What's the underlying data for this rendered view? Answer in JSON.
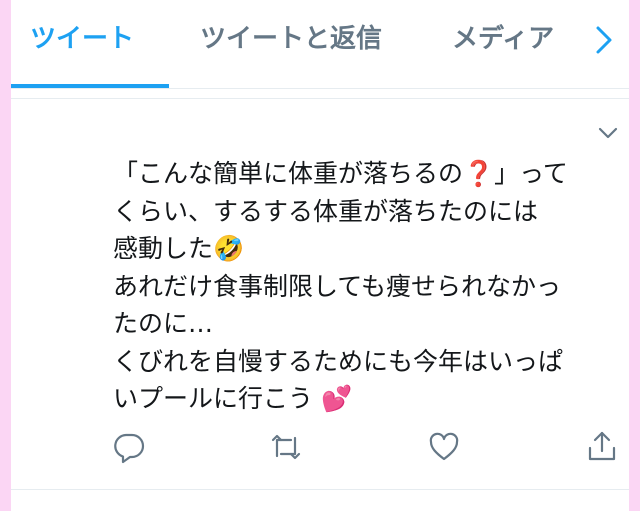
{
  "tabs": {
    "items": [
      {
        "label": "ツイート"
      },
      {
        "label": "ツイートと返信"
      },
      {
        "label": "メディア"
      }
    ],
    "active_index": 0,
    "next_icon": "chevron-right-icon"
  },
  "tweet": {
    "text": "「こんな簡単に体重が落ちるの❓」って\nくらい、するする体重が落ちたのには\n感動した🤣\nあれだけ食事制限しても痩せられなかっ\nたのに…\nくびれを自慢するためにも今年はいっぱ\nいプールに行こう 💕",
    "menu_icon": "chevron-down-icon",
    "actions": [
      "reply-icon",
      "retweet-icon",
      "like-icon",
      "share-icon"
    ]
  },
  "colors": {
    "accent": "#1da1f2",
    "tab_inactive": "#657786",
    "text": "#14171a",
    "icon": "#657786",
    "border_frame": "#fbd6f4"
  }
}
